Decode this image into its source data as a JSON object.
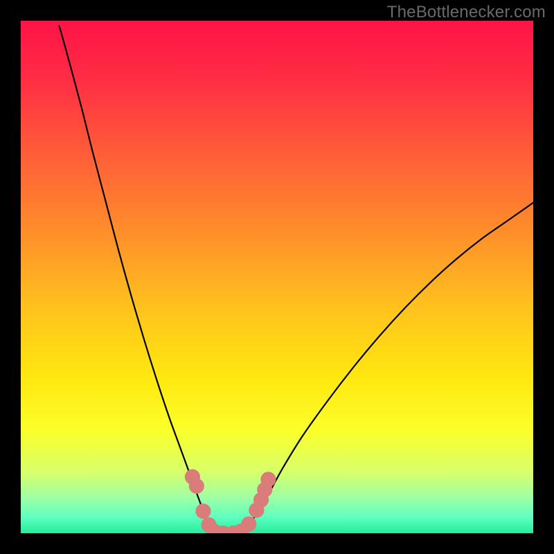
{
  "watermark": "TheBottlenecker.com",
  "chart_data": {
    "type": "line",
    "title": "",
    "xlabel": "",
    "ylabel": "",
    "xlim": [
      0,
      100
    ],
    "ylim": [
      0,
      100
    ],
    "grid": false,
    "background": {
      "type": "vertical-gradient",
      "stops": [
        {
          "offset": 0.0,
          "color": "#ff1347"
        },
        {
          "offset": 0.12,
          "color": "#ff2f43"
        },
        {
          "offset": 0.25,
          "color": "#ff5a39"
        },
        {
          "offset": 0.4,
          "color": "#ff8a2b"
        },
        {
          "offset": 0.55,
          "color": "#ffbf1e"
        },
        {
          "offset": 0.7,
          "color": "#ffe90f"
        },
        {
          "offset": 0.8,
          "color": "#fbff2a"
        },
        {
          "offset": 0.88,
          "color": "#d8ff6a"
        },
        {
          "offset": 0.93,
          "color": "#9fffa5"
        },
        {
          "offset": 0.97,
          "color": "#5cffbf"
        },
        {
          "offset": 1.0,
          "color": "#24ec9c"
        }
      ]
    },
    "series": [
      {
        "name": "left-branch",
        "stroke": "#000000",
        "points": [
          {
            "x": 7.5,
            "y": 99.0
          },
          {
            "x": 8.5,
            "y": 95.5
          },
          {
            "x": 10.0,
            "y": 90.0
          },
          {
            "x": 12.0,
            "y": 82.5
          },
          {
            "x": 14.0,
            "y": 74.5
          },
          {
            "x": 16.5,
            "y": 65.0
          },
          {
            "x": 19.0,
            "y": 55.5
          },
          {
            "x": 21.5,
            "y": 46.5
          },
          {
            "x": 24.0,
            "y": 38.0
          },
          {
            "x": 26.5,
            "y": 30.0
          },
          {
            "x": 29.0,
            "y": 22.5
          },
          {
            "x": 31.0,
            "y": 17.0
          },
          {
            "x": 33.0,
            "y": 11.5
          },
          {
            "x": 35.0,
            "y": 6.0
          },
          {
            "x": 36.5,
            "y": 2.5
          },
          {
            "x": 37.5,
            "y": 0.8
          },
          {
            "x": 38.5,
            "y": 0.0
          }
        ]
      },
      {
        "name": "right-branch",
        "stroke": "#000000",
        "points": [
          {
            "x": 42.5,
            "y": 0.0
          },
          {
            "x": 44.0,
            "y": 1.0
          },
          {
            "x": 45.5,
            "y": 3.0
          },
          {
            "x": 48.0,
            "y": 7.0
          },
          {
            "x": 51.0,
            "y": 12.5
          },
          {
            "x": 55.0,
            "y": 19.0
          },
          {
            "x": 60.0,
            "y": 26.0
          },
          {
            "x": 65.0,
            "y": 32.5
          },
          {
            "x": 70.0,
            "y": 38.5
          },
          {
            "x": 75.0,
            "y": 44.0
          },
          {
            "x": 80.0,
            "y": 49.0
          },
          {
            "x": 85.0,
            "y": 53.5
          },
          {
            "x": 90.0,
            "y": 57.5
          },
          {
            "x": 95.0,
            "y": 61.0
          },
          {
            "x": 100.0,
            "y": 64.5
          }
        ]
      }
    ],
    "markers": [
      {
        "name": "valley-dots",
        "fill": "#da7d7a",
        "r": 1.5,
        "points": [
          {
            "x": 33.5,
            "y": 11.0
          },
          {
            "x": 34.3,
            "y": 9.2
          },
          {
            "x": 35.6,
            "y": 4.3
          },
          {
            "x": 36.7,
            "y": 1.6
          },
          {
            "x": 37.8,
            "y": 0.3
          },
          {
            "x": 39.5,
            "y": 0.0
          },
          {
            "x": 41.5,
            "y": 0.0
          },
          {
            "x": 43.0,
            "y": 0.4
          },
          {
            "x": 44.5,
            "y": 1.8
          },
          {
            "x": 46.0,
            "y": 4.5
          },
          {
            "x": 46.9,
            "y": 6.5
          },
          {
            "x": 47.6,
            "y": 8.5
          },
          {
            "x": 48.3,
            "y": 10.5
          }
        ]
      }
    ]
  }
}
